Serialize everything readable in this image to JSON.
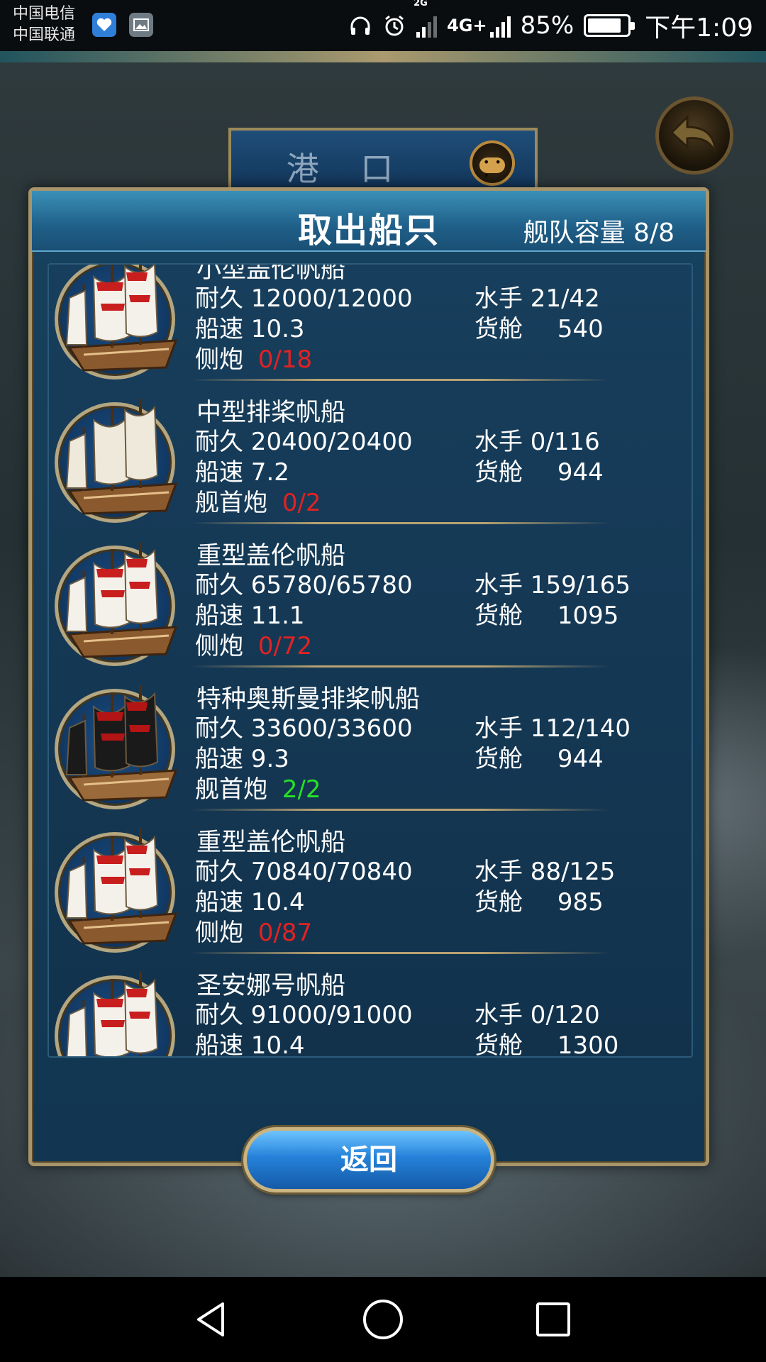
{
  "status_bar": {
    "carrier_1": "中国电信",
    "carrier_2": "中国联通",
    "network_1": "2G",
    "network_2": "4G+",
    "network_2_small": "4G+",
    "battery_text": "85%",
    "battery_level": 0.85,
    "time": "下午1:09"
  },
  "background": {
    "port_title": "港 口"
  },
  "dialog": {
    "title": "取出船只",
    "fleet_capacity": "舰队容量 8/8",
    "ships": [
      {
        "name": "小型盖伦帆船",
        "durability": "耐久 12000/12000",
        "speed": "船速 10.3",
        "weapon_label": "侧炮",
        "weapon_value": "0/18",
        "weapon_status": "red",
        "sailors": "水手 21/42",
        "cargo_label": "货舱",
        "cargo_value": "540"
      },
      {
        "name": "中型排桨帆船",
        "durability": "耐久 20400/20400",
        "speed": "船速 7.2",
        "weapon_label": "舰首炮",
        "weapon_value": "0/2",
        "weapon_status": "red",
        "sailors": "水手 0/116",
        "cargo_label": "货舱",
        "cargo_value": "944"
      },
      {
        "name": "重型盖伦帆船",
        "durability": "耐久 65780/65780",
        "speed": "船速 11.1",
        "weapon_label": "侧炮",
        "weapon_value": "0/72",
        "weapon_status": "red",
        "sailors": "水手 159/165",
        "cargo_label": "货舱",
        "cargo_value": "1095"
      },
      {
        "name": "特种奥斯曼排桨帆船",
        "durability": "耐久 33600/33600",
        "speed": "船速 9.3",
        "weapon_label": "舰首炮",
        "weapon_value": "2/2",
        "weapon_status": "green",
        "sailors": "水手 112/140",
        "cargo_label": "货舱",
        "cargo_value": "944"
      },
      {
        "name": "重型盖伦帆船",
        "durability": "耐久 70840/70840",
        "speed": "船速 10.4",
        "weapon_label": "侧炮",
        "weapon_value": "0/87",
        "weapon_status": "red",
        "sailors": "水手 88/125",
        "cargo_label": "货舱",
        "cargo_value": "985"
      },
      {
        "name": "圣安娜号帆船",
        "durability": "耐久 91000/91000",
        "speed": "船速 10.4",
        "weapon_label": "",
        "weapon_value": "",
        "weapon_status": "",
        "sailors": "水手 0/120",
        "cargo_label": "货舱",
        "cargo_value": "1300"
      }
    ],
    "return_label": "返回"
  },
  "colors": {
    "weapon_red": "#e22222",
    "weapon_green": "#26e226",
    "dialog_blue": "#16405c",
    "gold_trim": "#a8946a"
  },
  "icons": {
    "back": "back-arrow-icon",
    "chat": "chat-bubble-icon",
    "nav_back": "nav-back-triangle-icon",
    "nav_home": "nav-home-circle-icon",
    "nav_recents": "nav-recents-square-icon"
  }
}
